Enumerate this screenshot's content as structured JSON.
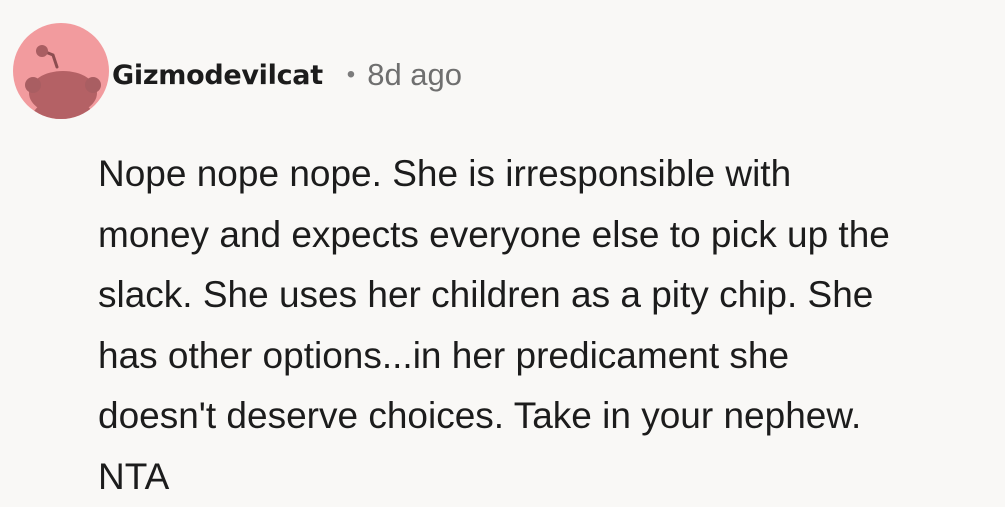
{
  "comment": {
    "author": "Gizmodevilcat",
    "separator": "•",
    "age": "8d ago",
    "avatar_icon": "snoo-avatar-icon",
    "avatar_color": "#f29b9e",
    "body_lines": [
      "Nope nope nope. She is irresponsible with",
      "money and expects everyone else to pick up the",
      "slack. She uses her children as a pity chip. She",
      "has other options...in her predicament she",
      "doesn't deserve choices. Take in your nephew.",
      "NTA"
    ]
  }
}
